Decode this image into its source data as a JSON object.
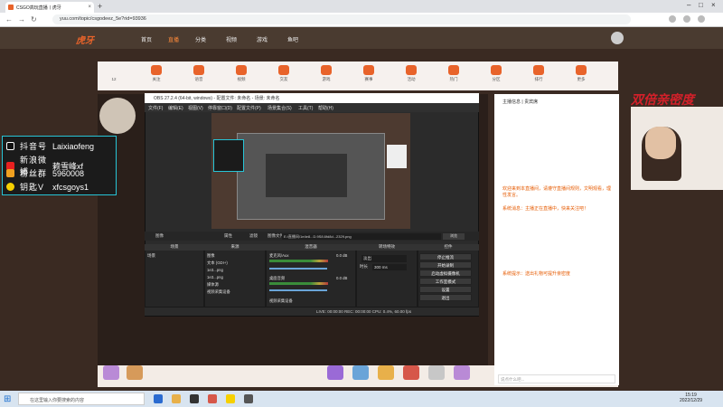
{
  "browser": {
    "tab_title": "CSGO高玩直播丨虎牙",
    "new_tab": "+",
    "url": "yuu.com/topic/csgodeez_5e?rid=93936",
    "nav_back": "←",
    "nav_forward": "→",
    "nav_reload": "↻"
  },
  "site": {
    "logo": "虎牙",
    "nav": [
      "首页",
      "直播",
      "分类",
      "视频",
      "游戏",
      "鱼吧"
    ],
    "categories": [
      {
        "label": "12",
        "color": "#f6f1ee"
      },
      {
        "label": "关注",
        "color": "#e8632a"
      },
      {
        "label": "语音",
        "color": "#e8632a"
      },
      {
        "label": "视频",
        "color": "#e8632a"
      },
      {
        "label": "交友",
        "color": "#e8632a"
      },
      {
        "label": "游戏",
        "color": "#e8632a"
      },
      {
        "label": "赛事",
        "color": "#e8632a"
      },
      {
        "label": "活动",
        "color": "#e8632a"
      },
      {
        "label": "热门",
        "color": "#e8632a"
      },
      {
        "label": "分区",
        "color": "#e8632a"
      },
      {
        "label": "排行",
        "color": "#e8632a"
      },
      {
        "label": "更多",
        "color": "#e8632a"
      }
    ]
  },
  "overlay": {
    "rows": [
      {
        "label": "抖音号",
        "value": "Laixiaofeng",
        "icon_color": "#111"
      },
      {
        "label": "新浪微博",
        "value": "赖雪峰xf",
        "icon_color": "#e62020"
      },
      {
        "label": "粉丝群",
        "value": "5960008",
        "icon_color": "#f0a020"
      },
      {
        "label": "钥匙V",
        "value": "xfcsgoys1",
        "icon_color": "#f6d000"
      }
    ],
    "promo": "双倍亲密度"
  },
  "obs": {
    "title": "OBS 27.2.4 (64-bit, windows) - 配置文件: 未命名 - 场景: 未命名",
    "menu": [
      "文件(F)",
      "编辑(E)",
      "视图(V)",
      "停靠窗口(D)",
      "配置文件(P)",
      "场景集合(S)",
      "工具(T)",
      "帮助(H)"
    ],
    "source_bar": {
      "label": "图像",
      "properties": "属性",
      "filters": "滤镜",
      "file_label": "图像文件",
      "path": "E:/直播间/1e4e8...D.9S8.6fd8d...2329.png",
      "browse": "浏览"
    },
    "docks": {
      "scenes": "场景",
      "sources": "来源",
      "mixer": "混音器",
      "transitions": "转场特效",
      "controls": "控件"
    },
    "scenes_list": [
      "场景"
    ],
    "sources_list": [
      "图像",
      "文本 (GDI+)",
      "1e3...png",
      "1e3...png",
      "媒体源",
      "视频采集设备"
    ],
    "mixer": [
      {
        "name": "麦克风/Aux",
        "db": "0.0 dB"
      },
      {
        "name": "桌面音频",
        "db": "0.0 dB"
      },
      {
        "name": "视频采集设备",
        "db": "0.0 dB"
      }
    ],
    "transition": {
      "type": "淡出",
      "duration_label": "时长",
      "duration": "300 ms"
    },
    "controls": [
      "停止推流",
      "开始录制",
      "启动虚拟摄像机",
      "工作室模式",
      "设置",
      "退出"
    ],
    "status": "LIVE: 00:00:00   REC: 00:00:00   CPU: 0.4%, 60.00 fps"
  },
  "chat": {
    "header": "主播信息 | 贵宾席",
    "lines": [
      "欢迎来到本直播间，请遵守直播间规则，文明观看，理性发言。",
      "系统消息：主播正在直播中，快来关注吧！",
      "系统提示：送出礼物可提升亲密度"
    ],
    "input_placeholder": "说点什么吧..."
  },
  "taskbar": {
    "search": "在这里输入你要搜索的内容",
    "time": "15:19",
    "date": "2022/12/29"
  }
}
